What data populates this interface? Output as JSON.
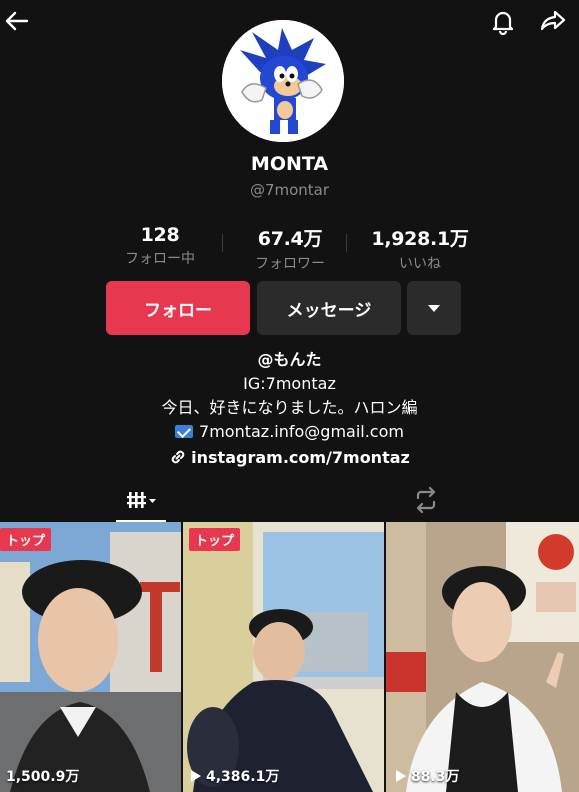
{
  "profile": {
    "name": "MONTA",
    "handle": "@7montar"
  },
  "stats": [
    {
      "value": "128",
      "label": "フォロー中"
    },
    {
      "value": "67.4万",
      "label": "フォロワー"
    },
    {
      "value": "1,928.1万",
      "label": "いいね"
    }
  ],
  "actions": {
    "follow_label": "フォロー",
    "message_label": "メッセージ"
  },
  "bio": {
    "line1": "@もんた",
    "line2": "IG:7montaz",
    "line3": "今日、好きになりました。ハロン編",
    "email": "7montaz.info@gmail.com",
    "link": "instagram.com/7montaz"
  },
  "icons": {
    "back": "back-arrow-icon",
    "bell": "bell-icon",
    "share": "share-icon",
    "grid": "video-grid-icon",
    "repost": "repost-icon",
    "link": "link-icon",
    "mail": "email-icon"
  },
  "colors": {
    "background": "#121212",
    "accent": "#e8384f",
    "secondary_button": "#2b2b2b",
    "muted_text": "#8a8a8a"
  },
  "videos": [
    {
      "badge": "トップ",
      "views": "1,500.9万"
    },
    {
      "badge": "トップ",
      "views": "4,386.1万"
    },
    {
      "badge": "",
      "views": "88.3万"
    }
  ]
}
